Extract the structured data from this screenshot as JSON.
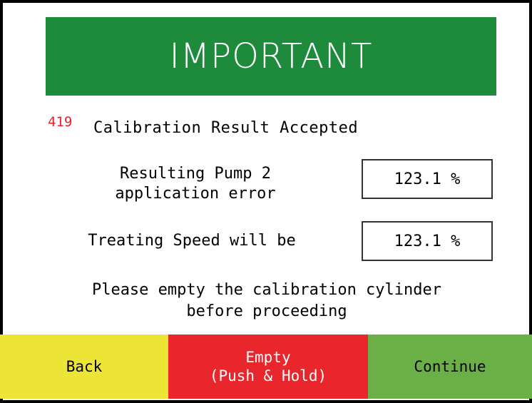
{
  "banner": {
    "title": "IMPORTANT"
  },
  "status": {
    "code": "419",
    "message": "Calibration Result Accepted"
  },
  "pump_error": {
    "label_line1": "Resulting Pump 2",
    "label_line2": "application error",
    "value": "123.1 %"
  },
  "treating_speed": {
    "label": "Treating Speed will be",
    "value": "123.1 %"
  },
  "instruction": {
    "line1": "Please empty the calibration cylinder",
    "line2": "before proceeding"
  },
  "buttons": {
    "back": "Back",
    "empty_line1": "Empty",
    "empty_line2": "(Push & Hold)",
    "continue": "Continue"
  },
  "colors": {
    "banner": "#1e8a3c",
    "status_code": "#e8202a",
    "back_button": "#ede536",
    "empty_button": "#e8262c",
    "continue_button": "#6ab046"
  }
}
